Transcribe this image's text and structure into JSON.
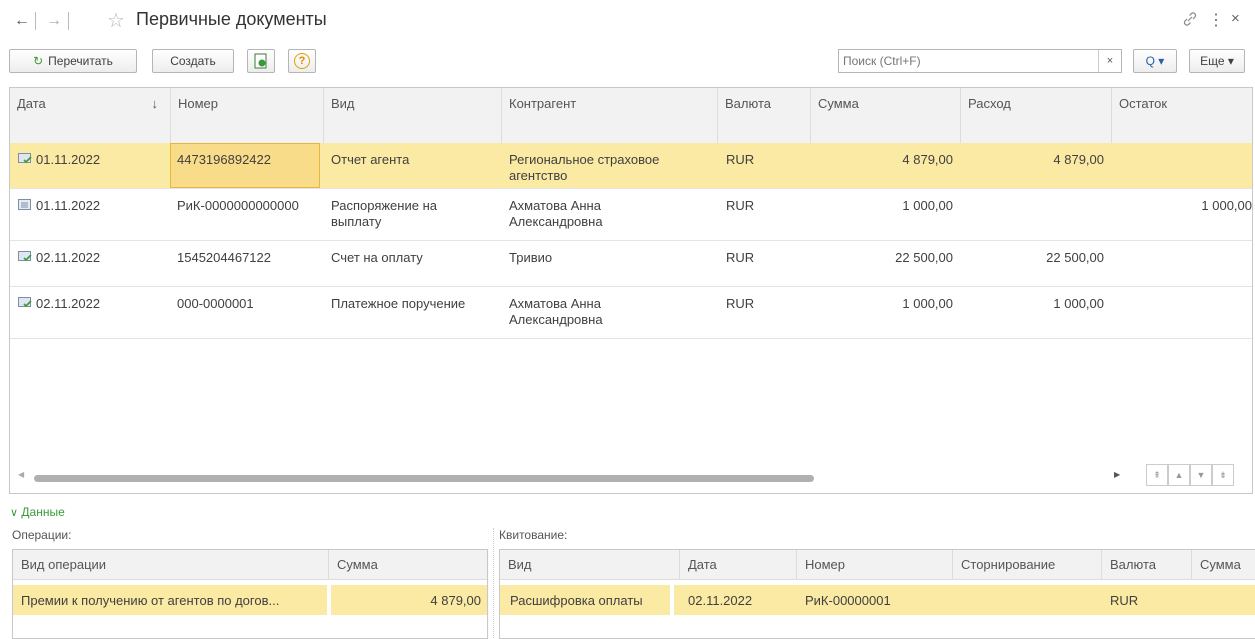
{
  "window": {
    "title": "Первичные документы",
    "back_glyph": "←",
    "forward_glyph": "→",
    "star_glyph": "☆",
    "link_glyph": "🔗",
    "more_glyph": "⋮",
    "close_glyph": "×"
  },
  "toolbar": {
    "reread_label": "Перечитать",
    "create_label": "Создать",
    "help_glyph": "?",
    "search_placeholder": "Поиск (Ctrl+F)",
    "search_clear_glyph": "×",
    "search_btn_glyph": "Q ▾",
    "more_label": "Еще ▾"
  },
  "grid": {
    "columns": [
      "Дата",
      "Номер",
      "Вид",
      "Контрагент",
      "Валюта",
      "Сумма",
      "Расход",
      "Остаток"
    ],
    "sort_glyph": "↓",
    "rows": [
      {
        "date": "01.11.2022",
        "number": "4473196892422",
        "kind": "Отчет агента",
        "contractor": "Региональное страховое агентство",
        "currency": "RUR",
        "sum": "4 879,00",
        "expense": "4 879,00",
        "rest": ""
      },
      {
        "date": "01.11.2022",
        "number": "РиК-0000000000000",
        "kind": "Распоряжение на выплату",
        "contractor": "Ахматова Анна Александровна",
        "currency": "RUR",
        "sum": "1 000,00",
        "expense": "",
        "rest": "1 000,00"
      },
      {
        "date": "02.11.2022",
        "number": "1545204467122",
        "kind": "Счет на оплату",
        "contractor": "Тривио",
        "currency": "RUR",
        "sum": "22 500,00",
        "expense": "22 500,00",
        "rest": ""
      },
      {
        "date": "02.11.2022",
        "number": "000-0000001",
        "kind": "Платежное поручение",
        "contractor": "Ахматова Анна Александровна",
        "currency": "RUR",
        "sum": "1 000,00",
        "expense": "1 000,00",
        "rest": ""
      }
    ],
    "selected_row": 0
  },
  "data_section": {
    "toggle_label": "Данные",
    "operations_label": "Операции:",
    "operations_columns": [
      "Вид операции",
      "Сумма"
    ],
    "operations_rows": [
      {
        "kind": "Премии к получению от агентов по догов...",
        "sum": "4 879,00"
      }
    ],
    "reconcile_label": "Квитование:",
    "reconcile_columns": [
      "Вид",
      "Дата",
      "Номер",
      "Сторнирование",
      "Валюта",
      "Сумма"
    ],
    "reconcile_rows": [
      {
        "kind": "Расшифровка оплаты",
        "date": "02.11.2022",
        "number": "РиК-00000001",
        "storno": "",
        "currency": "RUR",
        "sum": ""
      }
    ]
  },
  "colors": {
    "selected": "#fbeaa4",
    "focus_border": "#e5b73b",
    "accent_green": "#3a9a3a"
  }
}
